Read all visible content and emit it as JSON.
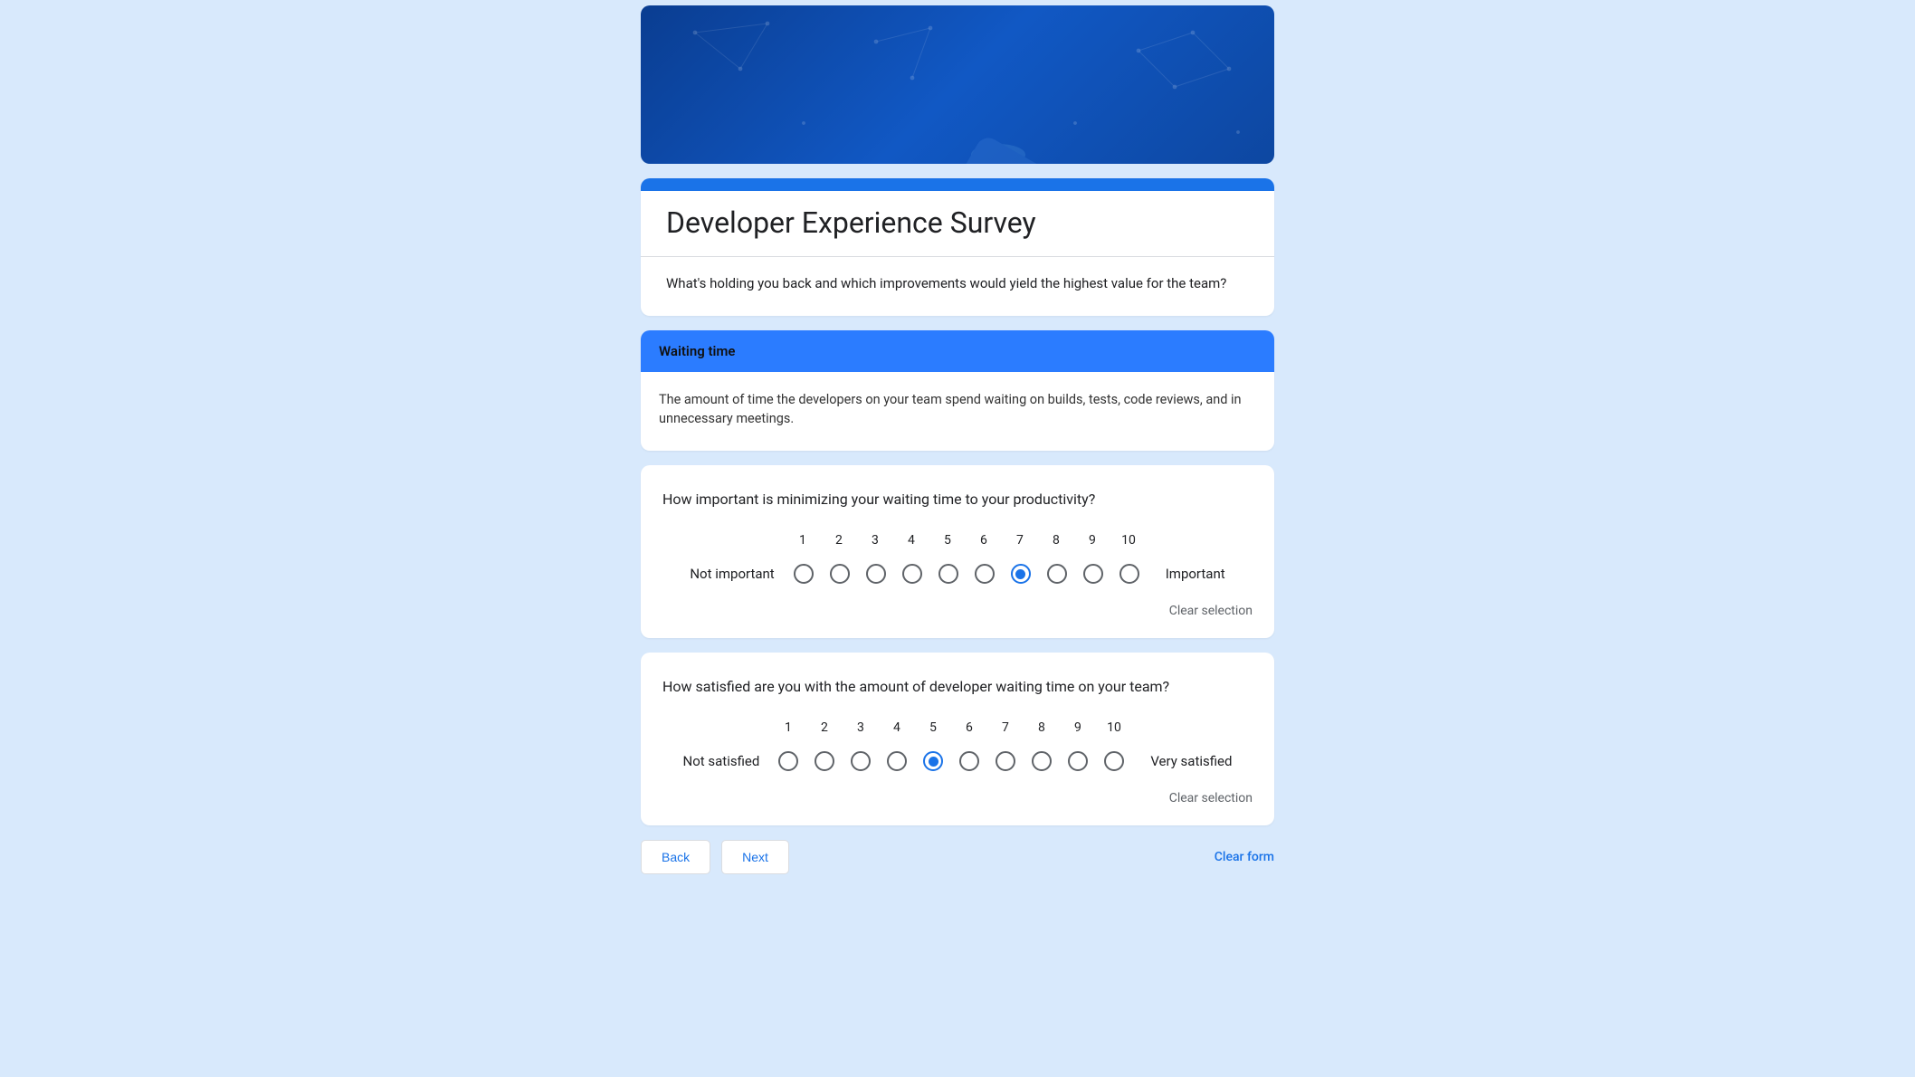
{
  "form": {
    "title": "Developer Experience Survey",
    "subtitle": "What's holding you back and which improvements would yield the highest value for the team?"
  },
  "section": {
    "title": "Waiting time",
    "description": "The amount of time the developers on your team spend waiting on builds, tests, code reviews, and in unnecessary meetings."
  },
  "question1": {
    "title": "How important is minimizing your waiting time to your productivity?",
    "leftLabel": "Not important",
    "rightLabel": "Important",
    "clearLabel": "Clear selection",
    "selected": 7,
    "scale": {
      "n1": "1",
      "n2": "2",
      "n3": "3",
      "n4": "4",
      "n5": "5",
      "n6": "6",
      "n7": "7",
      "n8": "8",
      "n9": "9",
      "n10": "10"
    }
  },
  "question2": {
    "title": "How satisfied are you with the amount of developer waiting time on your team?",
    "leftLabel": "Not satisfied",
    "rightLabel": "Very satisfied",
    "clearLabel": "Clear selection",
    "selected": 5,
    "scale": {
      "n1": "1",
      "n2": "2",
      "n3": "3",
      "n4": "4",
      "n5": "5",
      "n6": "6",
      "n7": "7",
      "n8": "8",
      "n9": "9",
      "n10": "10"
    }
  },
  "footer": {
    "back": "Back",
    "next": "Next",
    "clearForm": "Clear form"
  }
}
